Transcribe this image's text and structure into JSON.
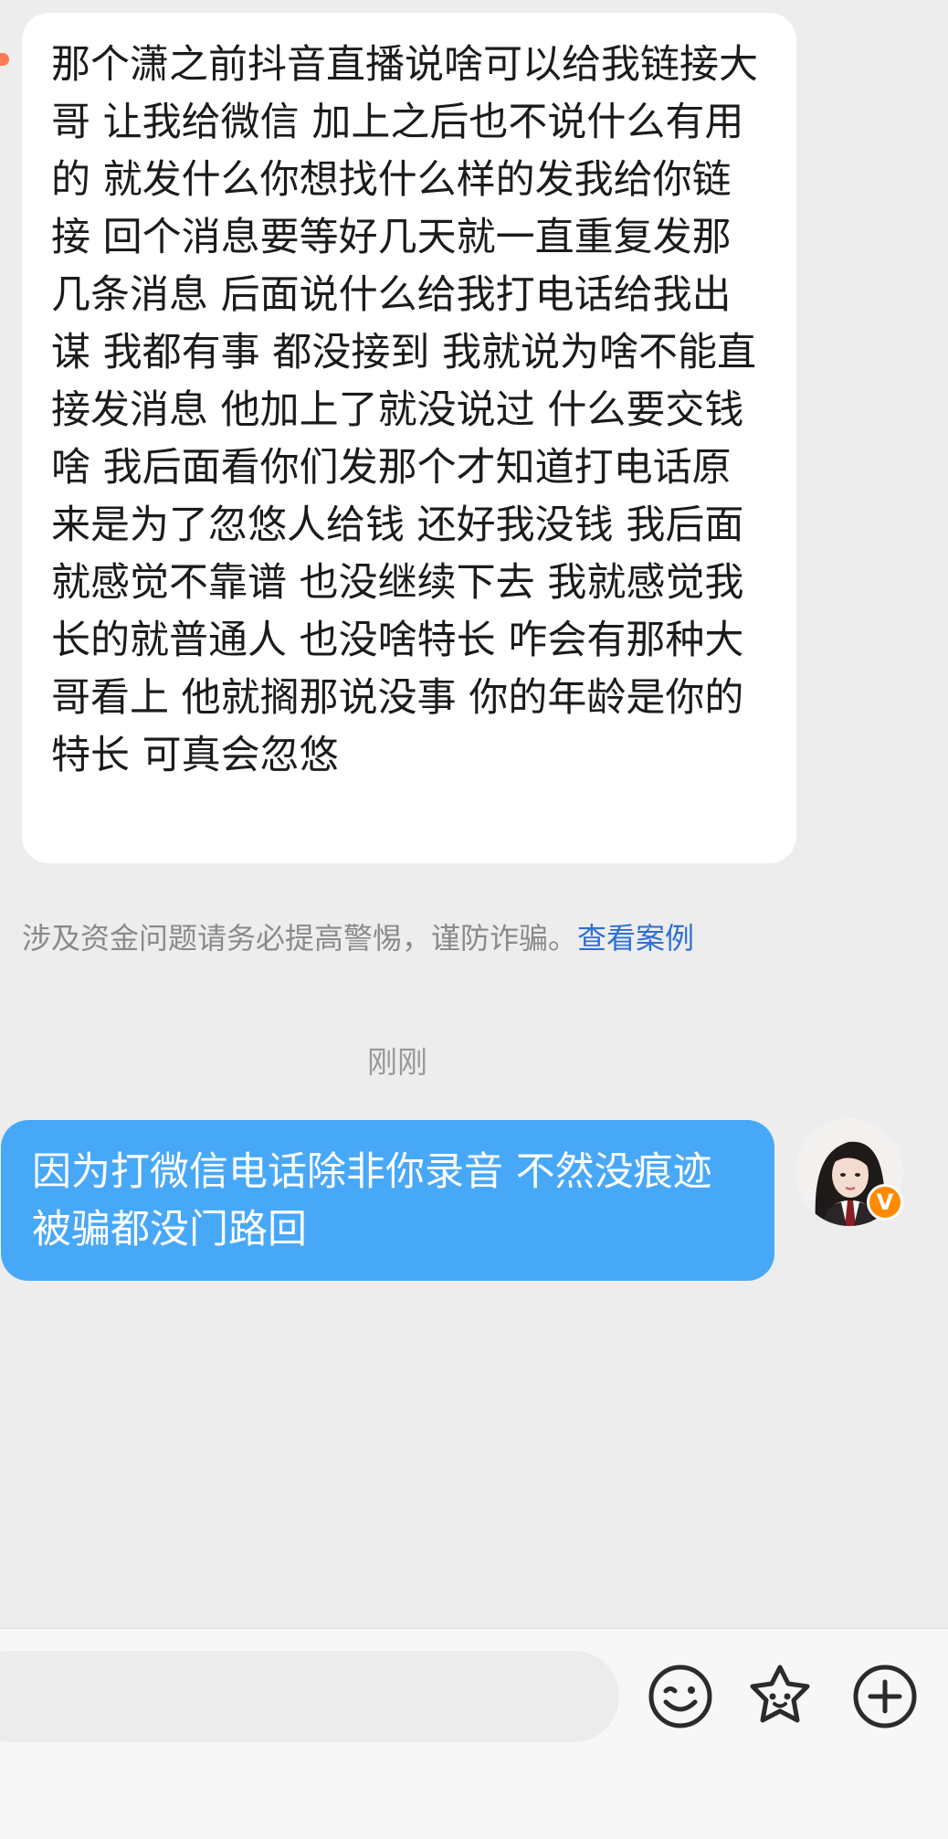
{
  "conversation": {
    "incoming_message": "那个潇之前抖音直播说啥可以给我链接大哥 让我给微信 加上之后也不说什么有用的 就发什么你想找什么样的发我给你链接 回个消息要等好几天就一直重复发那几条消息 后面说什么给我打电话给我出谋 我都有事 都没接到  我就说为啥不能直接发消息 他加上了就没说过 什么要交钱啥 我后面看你们发那个才知道打电话原来是为了忽悠人给钱 还好我没钱 我后面就感觉不靠谱 也没继续下去 我就感觉我长的就普通人 也没啥特长 咋会有那种大哥看上 他就搁那说没事 你的年龄是你的特长 可真会忽悠",
    "warning_text": "涉及资金问题请务必提高警惕，谨防诈骗。",
    "warning_link": "查看案例",
    "timestamp": "刚刚",
    "outgoing_message": "因为打微信电话除非你录音 不然没痕迹 被骗都没门路回",
    "sender_badge": "V"
  },
  "input_bar": {
    "placeholder": "",
    "icons": [
      "emoji-icon",
      "sticker-icon",
      "add-icon"
    ]
  },
  "colors": {
    "outgoing_bubble": "#48a8f8",
    "incoming_bubble": "#ffffff",
    "link": "#2e6fd1",
    "badge": "#ff8a00"
  }
}
